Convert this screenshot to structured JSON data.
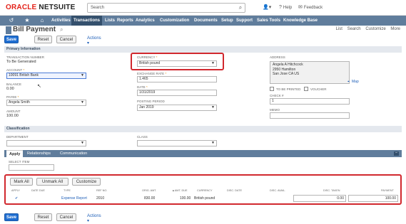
{
  "brand": {
    "oracle": "ORACLE",
    "netsuite": "NETSUITE",
    "oracle_color": "#e32119"
  },
  "header": {
    "search_placeholder": "Search",
    "help_label": "Help",
    "feedback_label": "Feedback"
  },
  "nav": {
    "items": [
      "Activities",
      "Transactions",
      "Lists",
      "Reports",
      "Analytics",
      "Customization",
      "Documents",
      "Setup",
      "Support",
      "Sales Tools",
      "Knowledge Base"
    ],
    "active": "Transactions",
    "bar_color": "#607d9c"
  },
  "page": {
    "title": "Bill Payment",
    "links": [
      "List",
      "Search",
      "Customize",
      "More"
    ]
  },
  "toolbar": {
    "save_label": "Save",
    "reset_label": "Reset",
    "cancel_label": "Cancel",
    "actions_label": "Actions"
  },
  "primary": {
    "section_title": "Primary Information",
    "transaction_number_label": "TRANSACTION NUMBER",
    "transaction_number_value": "To Be Generated",
    "account_label": "ACCOUNT",
    "account_value": "10091 British Bank",
    "balance_label": "BALANCE",
    "balance_value": "0.00",
    "payee_label": "PAYEE",
    "payee_value": "Angela Smith",
    "amount_label": "AMOUNT",
    "amount_value": "100.00",
    "currency_label": "CURRENCY",
    "currency_value": "British pound",
    "exchange_rate_label": "EXCHANGE RATE",
    "exchange_rate_value": "1.465",
    "date_label": "DATE",
    "date_value": "1/31/2019",
    "posting_period_label": "POSTING PERIOD",
    "posting_period_value": "Jan 2019",
    "address_label": "ADDRESS",
    "address_lines": [
      "Angela A Hitchcock",
      "2950 Hamilton",
      "San Jose CA US"
    ],
    "map_label": "Map",
    "to_be_printed_label": "TO BE PRINTED",
    "voucher_label": "VOUCHER",
    "check_label": "CHECK #",
    "check_value": "1",
    "memo_label": "MEMO"
  },
  "classification": {
    "section_title": "Classification",
    "department_label": "DEPARTMENT",
    "class_label": "CLASS"
  },
  "tabs": {
    "items": [
      "Apply",
      "Relationships",
      "Communication"
    ],
    "active": "Apply"
  },
  "apply": {
    "select_item_label": "SELECT ITEM",
    "mark_all_label": "Mark All",
    "unmark_all_label": "Unmark All",
    "customize_label": "Customize",
    "columns": [
      "APPLY",
      "DATE DUE",
      "TYPE",
      "REF NO.",
      "ORIG. AMT.",
      "▲AMT. DUE",
      "CURRENCY",
      "DISC. DATE",
      "DISC. AVAIL.",
      "DISC. TAKEN",
      "PAYMENT"
    ],
    "row": {
      "apply": "✔",
      "date_due": "",
      "type": "Expense Report",
      "ref_no": "2010",
      "orig_amt": "830.00",
      "amt_due": "100.00",
      "currency": "British pound",
      "disc_date": "",
      "disc_avail": "",
      "disc_taken": "0.00",
      "payment": "100.00"
    }
  },
  "highlight_color": "#d1282e"
}
